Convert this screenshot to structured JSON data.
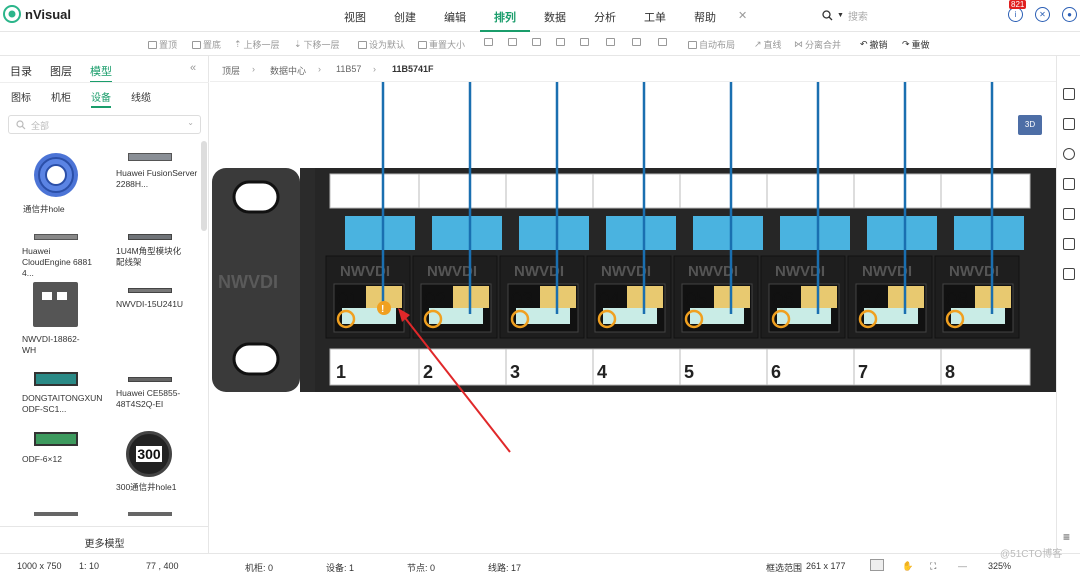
{
  "app": {
    "name": "nVisual"
  },
  "menu": {
    "items": [
      "视图",
      "创建",
      "编辑",
      "排列",
      "数据",
      "分析",
      "工单",
      "帮助"
    ],
    "active_index": 3
  },
  "search": {
    "placeholder": "搜索"
  },
  "notifications": {
    "count": "821"
  },
  "toolbar": {
    "items": [
      "置顶",
      "置底",
      "上移一层",
      "下移一层",
      "设为默认",
      "重置大小",
      "自动布局",
      "直线",
      "分离合并",
      "撤销",
      "重做"
    ]
  },
  "left_panel": {
    "tabs": [
      "目录",
      "图层",
      "模型"
    ],
    "active_tab": "模型",
    "subtabs": [
      "图标",
      "机柜",
      "设备",
      "线缆"
    ],
    "active_subtab": "设备",
    "search_placeholder": "全部",
    "collapse_glyph": "«",
    "items": [
      {
        "label": "通信井hole",
        "icon": "manhole-icon"
      },
      {
        "label": "Huawei FusionServer 2288H...",
        "icon": "server-icon"
      },
      {
        "label": "Huawei CloudEngine 6881 4...",
        "icon": "switch-icon"
      },
      {
        "label": "1U4M角型模块化配线架",
        "icon": "patch-panel-icon"
      },
      {
        "label": "NWVDI-18862-WH",
        "icon": "faceplate-icon"
      },
      {
        "label": "NWVDI-15U241U",
        "icon": "rack-unit-icon"
      },
      {
        "label": "DONGTAITONGXUN ODF-SC1...",
        "icon": "odf-icon"
      },
      {
        "label": "Huawei CE5855-48T4S2Q-EI",
        "icon": "switch-icon"
      },
      {
        "label": "ODF-6×12",
        "icon": "odf-icon"
      },
      {
        "label": "300通信井hole1",
        "icon": "manhole-300-icon"
      }
    ],
    "manhole_number": "300",
    "more_label": "更多模型"
  },
  "breadcrumb": [
    "顶层",
    "数据中心",
    "11B57",
    "11B5741F"
  ],
  "canvas": {
    "brand_text": "NWVDI",
    "ports": [
      "01",
      "02",
      "03",
      "04",
      "05",
      "06",
      "07",
      "08"
    ],
    "port_numbers": [
      "1",
      "2",
      "3",
      "4",
      "5",
      "6",
      "7",
      "8"
    ],
    "warning_glyph": "!",
    "colors": {
      "panel": "#2b2b2b",
      "port_label": "#4ab3e0",
      "cable": "#1a6fb0",
      "ring": "#f0a020",
      "arrow": "#e0282a"
    }
  },
  "view_3d_label": "3D",
  "status": {
    "canvas_size": "1000 x 750",
    "scale": "1: 10",
    "coords": "77 , 400",
    "racks": "机柜: 0",
    "devices": "设备: 1",
    "nodes": "节点: 0",
    "links": "线路: 17",
    "selection_label": "框选范围",
    "selection_size": "261 x 177",
    "zoom": "325%",
    "watermark": "@51CTO博客"
  }
}
